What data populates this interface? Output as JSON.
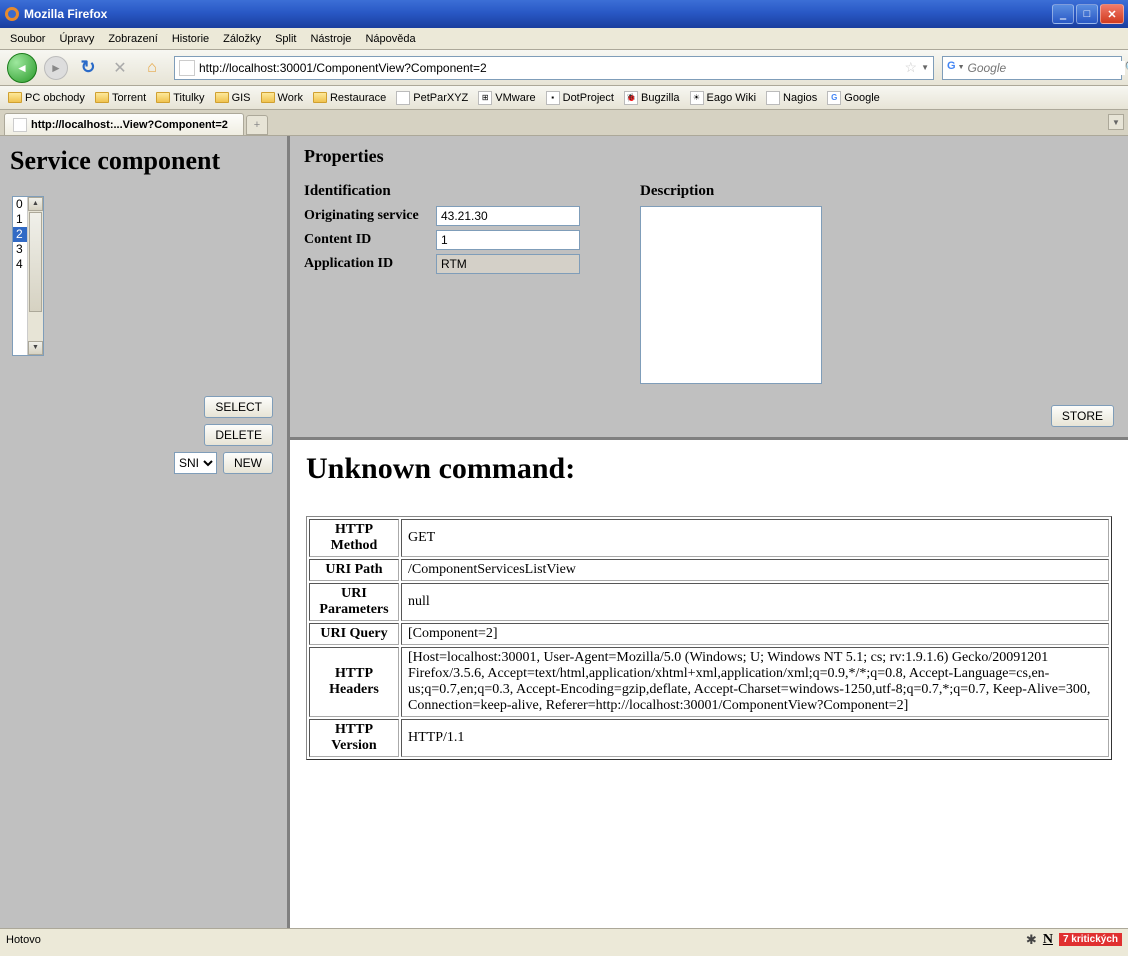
{
  "window": {
    "title": "Mozilla Firefox"
  },
  "menu": [
    "Soubor",
    "Úpravy",
    "Zobrazení",
    "Historie",
    "Záložky",
    "Split",
    "Nástroje",
    "Nápověda"
  ],
  "nav": {
    "url": "http://localhost:30001/ComponentView?Component=2",
    "search_placeholder": "Google"
  },
  "bookmarks": [
    {
      "label": "PC obchody",
      "type": "folder"
    },
    {
      "label": "Torrent",
      "type": "folder"
    },
    {
      "label": "Titulky",
      "type": "folder"
    },
    {
      "label": "GIS",
      "type": "folder"
    },
    {
      "label": "Work",
      "type": "folder"
    },
    {
      "label": "Restaurace",
      "type": "folder"
    },
    {
      "label": "PetParXYZ",
      "type": "page"
    },
    {
      "label": "VMware",
      "type": "page"
    },
    {
      "label": "DotProject",
      "type": "page"
    },
    {
      "label": "Bugzilla",
      "type": "page"
    },
    {
      "label": "Eago Wiki",
      "type": "page"
    },
    {
      "label": "Nagios",
      "type": "page"
    },
    {
      "label": "Google",
      "type": "page"
    }
  ],
  "tab": {
    "label": "http://localhost:...View?Component=2"
  },
  "left": {
    "heading": "Service component",
    "items": [
      "0",
      "1",
      "2",
      "3",
      "4"
    ],
    "selected_index": 2,
    "buttons": {
      "select": "SELECT",
      "delete": "DELETE",
      "new": "NEW"
    },
    "dropdown_value": "SNI"
  },
  "props": {
    "heading": "Properties",
    "ident_heading": "Identification",
    "desc_heading": "Description",
    "fields": {
      "orig_label": "Originating service",
      "orig_value": "43.21.30",
      "cid_label": "Content ID",
      "cid_value": "1",
      "aid_label": "Application ID",
      "aid_value": "RTM"
    },
    "desc_value": "",
    "store": "STORE"
  },
  "unknown": {
    "heading": "Unknown command:",
    "rows": [
      {
        "h": "HTTP Method",
        "v": "GET"
      },
      {
        "h": "URI Path",
        "v": "/ComponentServicesListView"
      },
      {
        "h": "URI Parameters",
        "v": "null"
      },
      {
        "h": "URI Query",
        "v": "[Component=2]"
      },
      {
        "h": "HTTP Headers",
        "v": "[Host=localhost:30001, User-Agent=Mozilla/5.0 (Windows; U; Windows NT 5.1; cs; rv:1.9.1.6) Gecko/20091201 Firefox/3.5.6, Accept=text/html,application/xhtml+xml,application/xml;q=0.9,*/*;q=0.8, Accept-Language=cs,en-us;q=0.7,en;q=0.3, Accept-Encoding=gzip,deflate, Accept-Charset=windows-1250,utf-8;q=0.7,*;q=0.7, Keep-Alive=300, Connection=keep-alive, Referer=http://localhost:30001/ComponentView?Component=2]"
      },
      {
        "h": "HTTP Version",
        "v": "HTTP/1.1"
      }
    ]
  },
  "status": {
    "left": "Hotovo",
    "badge": "7 kritických"
  }
}
